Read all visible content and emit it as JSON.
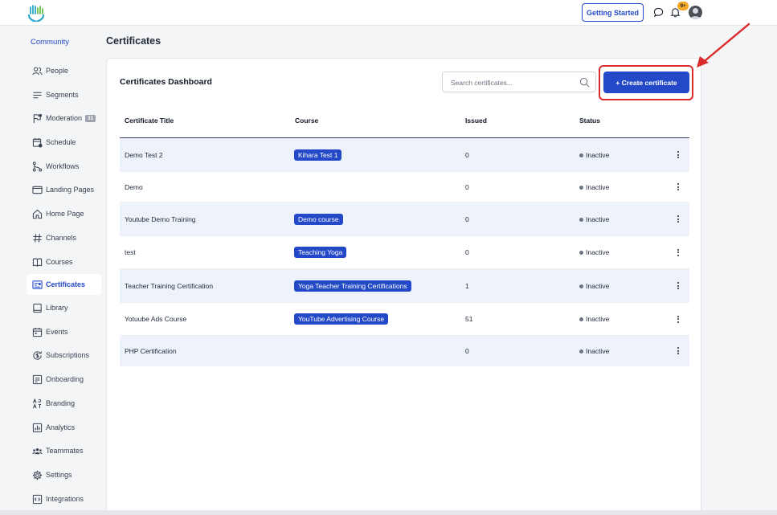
{
  "topbar": {
    "getting_started_label": "Getting Started",
    "notification_count": "9+"
  },
  "sidebar": {
    "header": "Community",
    "items": [
      {
        "label": "People",
        "icon": "people-icon"
      },
      {
        "label": "Segments",
        "icon": "segments-icon"
      },
      {
        "label": "Moderation",
        "icon": "moderation-icon",
        "badge": "31"
      },
      {
        "label": "Schedule",
        "icon": "schedule-icon"
      },
      {
        "label": "Workflows",
        "icon": "workflows-icon"
      },
      {
        "label": "Landing Pages",
        "icon": "landing-pages-icon"
      },
      {
        "label": "Home Page",
        "icon": "home-icon"
      },
      {
        "label": "Channels",
        "icon": "hash-icon"
      },
      {
        "label": "Courses",
        "icon": "book-icon"
      },
      {
        "label": "Certificates",
        "icon": "certificate-icon",
        "active": true
      },
      {
        "label": "Library",
        "icon": "library-icon"
      },
      {
        "label": "Events",
        "icon": "calendar-icon"
      },
      {
        "label": "Subscriptions",
        "icon": "subscriptions-icon"
      },
      {
        "label": "Onboarding",
        "icon": "onboarding-icon"
      },
      {
        "label": "Branding",
        "icon": "branding-icon"
      },
      {
        "label": "Analytics",
        "icon": "analytics-icon"
      },
      {
        "label": "Teammates",
        "icon": "teammates-icon"
      },
      {
        "label": "Settings",
        "icon": "gear-icon"
      },
      {
        "label": "Integrations",
        "icon": "integrations-icon"
      }
    ]
  },
  "main": {
    "page_title": "Certificates",
    "card_title": "Certificates Dashboard",
    "search_placeholder": "Search certificates...",
    "create_button_label": "+ Create certificate",
    "table": {
      "headers": [
        "Certificate Title",
        "Course",
        "Issued",
        "Status"
      ],
      "rows": [
        {
          "title": "Demo Test 2",
          "course": "Kihara Test 1",
          "issued": "0",
          "status": "Inactive"
        },
        {
          "title": "Demo",
          "course": "",
          "issued": "0",
          "status": "Inactive"
        },
        {
          "title": "Youtube Demo Training",
          "course": "Demo course",
          "issued": "0",
          "status": "Inactive"
        },
        {
          "title": "test",
          "course": "Teaching Yoga",
          "issued": "0",
          "status": "Inactive"
        },
        {
          "title": "Teacher Training Certification",
          "course": "Yoga Teacher Training Certifications",
          "issued": "1",
          "status": "Inactive"
        },
        {
          "title": "Yotuube Ads Course",
          "course": "YouTube Advertising Course",
          "issued": "51",
          "status": "Inactive"
        },
        {
          "title": "PHP Certification",
          "course": "",
          "issued": "0",
          "status": "Inactive"
        }
      ]
    }
  },
  "colors": {
    "accent": "#2449c8",
    "highlight": "#d92b2b",
    "badge": "#f5a623"
  }
}
